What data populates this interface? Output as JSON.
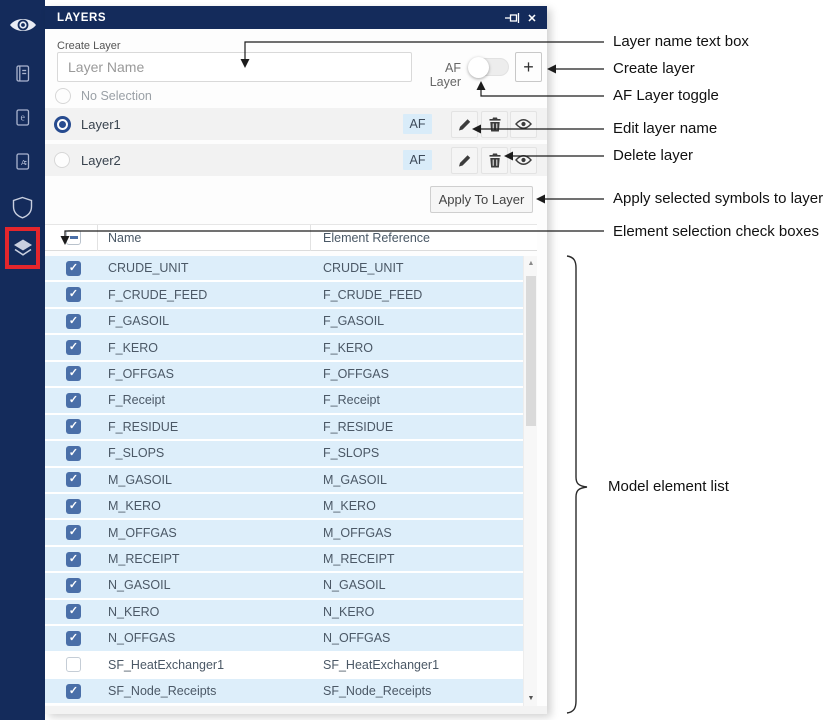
{
  "panel": {
    "title": "LAYERS",
    "create": {
      "label": "Create Layer",
      "input_placeholder": "Layer Name",
      "af_label": "AF Layer",
      "af_toggle_state": "off",
      "add_button": "+"
    },
    "no_selection_label": "No Selection",
    "layers": [
      {
        "name": "Layer1",
        "badge": "AF",
        "selected": true
      },
      {
        "name": "Layer2",
        "badge": "AF",
        "selected": false
      }
    ],
    "apply_button": "Apply To Layer",
    "table": {
      "columns": [
        "Name",
        "Element Reference"
      ],
      "header_checkbox_state": "indeterminate",
      "rows": [
        {
          "name": "CRUDE_UNIT",
          "ref": "CRUDE_UNIT",
          "checked": true
        },
        {
          "name": "F_CRUDE_FEED",
          "ref": "F_CRUDE_FEED",
          "checked": true
        },
        {
          "name": "F_GASOIL",
          "ref": "F_GASOIL",
          "checked": true
        },
        {
          "name": "F_KERO",
          "ref": "F_KERO",
          "checked": true
        },
        {
          "name": "F_OFFGAS",
          "ref": "F_OFFGAS",
          "checked": true
        },
        {
          "name": "F_Receipt",
          "ref": "F_Receipt",
          "checked": true
        },
        {
          "name": "F_RESIDUE",
          "ref": "F_RESIDUE",
          "checked": true
        },
        {
          "name": "F_SLOPS",
          "ref": "F_SLOPS",
          "checked": true
        },
        {
          "name": "M_GASOIL",
          "ref": "M_GASOIL",
          "checked": true
        },
        {
          "name": "M_KERO",
          "ref": "M_KERO",
          "checked": true
        },
        {
          "name": "M_OFFGAS",
          "ref": "M_OFFGAS",
          "checked": true
        },
        {
          "name": "M_RECEIPT",
          "ref": "M_RECEIPT",
          "checked": true
        },
        {
          "name": "N_GASOIL",
          "ref": "N_GASOIL",
          "checked": true
        },
        {
          "name": "N_KERO",
          "ref": "N_KERO",
          "checked": true
        },
        {
          "name": "N_OFFGAS",
          "ref": "N_OFFGAS",
          "checked": true
        },
        {
          "name": "SF_HeatExchanger1",
          "ref": "SF_HeatExchanger1",
          "checked": false
        },
        {
          "name": "SF_Node_Receipts",
          "ref": "SF_Node_Receipts",
          "checked": true
        }
      ]
    },
    "titlebar_icons": {
      "close_glyph": "✕",
      "pin_icon": "pin-horizontal"
    }
  },
  "sidebar": {
    "icons": [
      "app-logo-eye",
      "journal",
      "events",
      "details",
      "shield",
      "layers"
    ],
    "highlighted_icon": "layers",
    "highlight_color": "#e4262c"
  },
  "annotations": [
    {
      "label": "Layer name text box"
    },
    {
      "label": "Create layer"
    },
    {
      "label": "AF Layer toggle"
    },
    {
      "label": "Edit layer name"
    },
    {
      "label": "Delete layer"
    },
    {
      "label": "Apply selected symbols to layer"
    },
    {
      "label": "Element selection check boxes"
    },
    {
      "label": "Model element list"
    }
  ],
  "colors": {
    "navy": "#142b5b",
    "row_blue": "#ddeefa",
    "checkbox_blue": "#4a6fa8",
    "badge_bg": "#d9ecf9",
    "highlight_red": "#e4262c"
  },
  "scrollbar": {
    "up_glyph": "▲",
    "down_glyph": "▼"
  }
}
